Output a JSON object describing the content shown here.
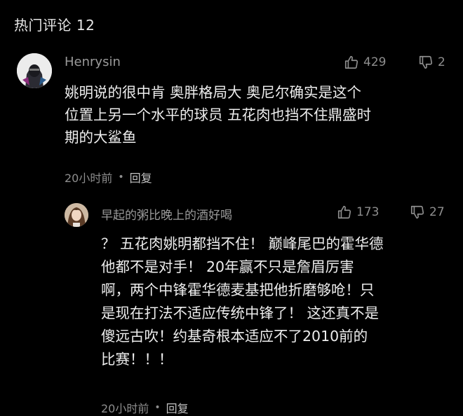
{
  "header": {
    "title": "热门评论 12"
  },
  "comment": {
    "author": "Henrysin",
    "avatar_icon": "hooded-figure-avatar",
    "likes": "429",
    "dislikes": "2",
    "lines": [
      "姚明说的很中肯 奥胖格局大 奥尼尔确实是这个",
      "位置上另一个水平的球员 五花肉也挡不住鼎盛时",
      "期的大鲨鱼"
    ],
    "time": "20小时前",
    "reply_label": "回复"
  },
  "reply": {
    "author": "早起的粥比晚上的酒好喝",
    "avatar_icon": "woman-photo-avatar",
    "likes": "173",
    "dislikes": "27",
    "lines": [
      "？ 五花肉姚明都挡不住！ 巅峰尾巴的霍华德",
      "他都不是对手！ 20年赢不只是詹眉厉害",
      "啊，两个中锋霍华德麦基把他折磨够呛！只",
      "是现在打法不适应传统中锋了！ 这还真不是",
      "傻远古吹！约基奇根本适应不了2010前的",
      "比赛！！！"
    ],
    "time": "20小时前",
    "reply_label": "回复"
  },
  "colors": {
    "background": "#000000",
    "text": "#ededed",
    "muted": "#8e8e8e"
  }
}
